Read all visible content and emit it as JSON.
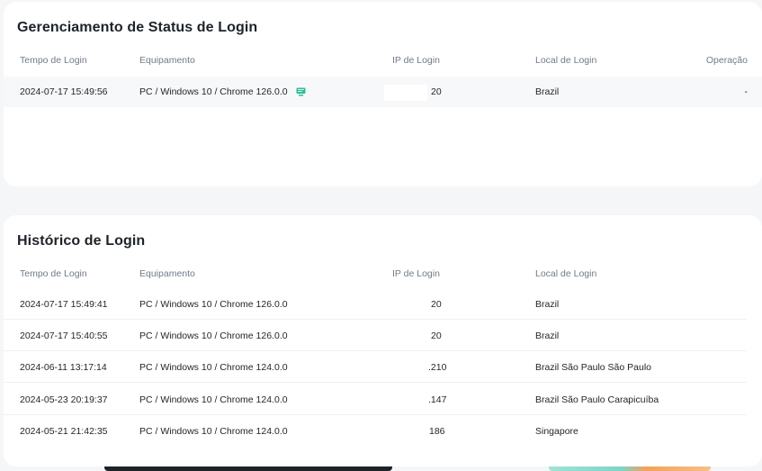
{
  "status_card": {
    "title": "Gerenciamento de Status de Login",
    "columns": {
      "time": "Tempo de Login",
      "device": "Equipamento",
      "ip": "IP de Login",
      "location": "Local de Login",
      "operation": "Operação"
    },
    "rows": [
      {
        "time": "2024-07-17 15:49:56",
        "device": "PC / Windows 10 / Chrome 126.0.0",
        "ip": "20",
        "location": "Brazil",
        "operation": "-"
      }
    ]
  },
  "history_card": {
    "title": "Histórico de Login",
    "columns": {
      "time": "Tempo de Login",
      "device": "Equipamento",
      "ip": "IP de Login",
      "location": "Local de Login"
    },
    "rows": [
      {
        "time": "2024-07-17 15:49:41",
        "device": "PC / Windows 10 / Chrome 126.0.0",
        "ip": "20",
        "location": "Brazil"
      },
      {
        "time": "2024-07-17 15:40:55",
        "device": "PC / Windows 10 / Chrome 126.0.0",
        "ip": "20",
        "location": "Brazil"
      },
      {
        "time": "2024-06-11 13:17:14",
        "device": "PC / Windows 10 / Chrome 124.0.0",
        "ip": ".210",
        "location": "Brazil São Paulo São Paulo"
      },
      {
        "time": "2024-05-23 20:19:37",
        "device": "PC / Windows 10 / Chrome 124.0.0",
        "ip": ".147",
        "location": "Brazil São Paulo Carapicuíba"
      },
      {
        "time": "2024-05-21 21:42:35",
        "device": "PC / Windows 10 / Chrome 124.0.0",
        "ip": "186",
        "location": "Singapore"
      }
    ]
  },
  "colors": {
    "accent_icon": "#2dbd96",
    "row_highlight": "#f7f8fa"
  },
  "icons": {
    "current_device": "monitor-icon"
  }
}
